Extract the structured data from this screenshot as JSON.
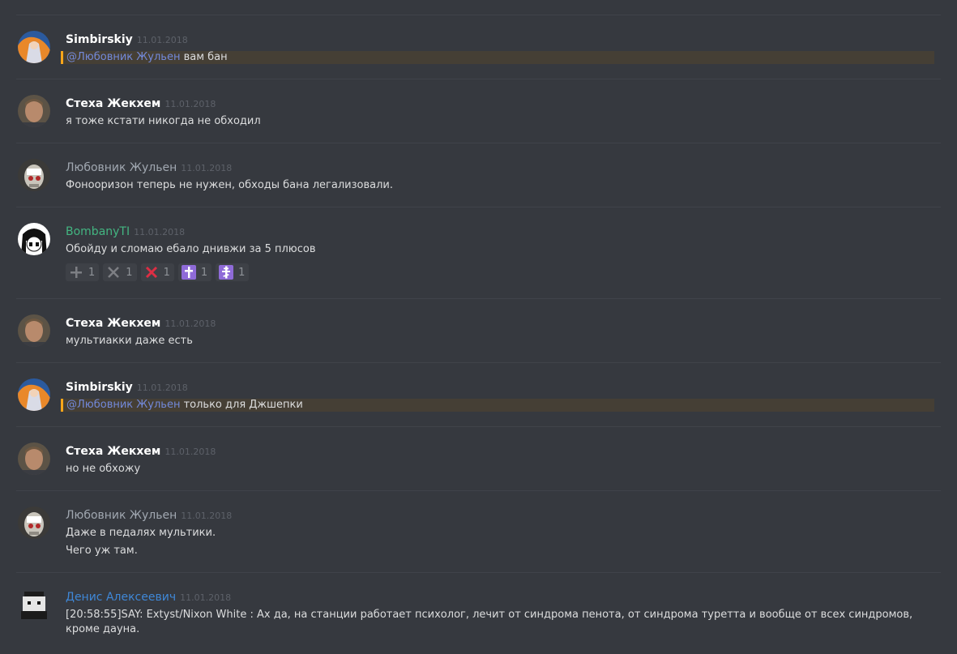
{
  "colors": {
    "background": "#36393f",
    "divider": "#40434a",
    "mention_highlight": "#453f35",
    "mention_bar": "#faa61a",
    "mention_text": "#7289da",
    "green_user": "#43b581",
    "blue_user": "#3f87d6"
  },
  "messages": [
    {
      "author": "Simbirskiy",
      "timestamp": "11.01.2018",
      "avatar": "anime-avatar-icon",
      "mention": "@Любовник Жульен",
      "text": " вам бан"
    },
    {
      "author": "Стеха Жекхем",
      "timestamp": "11.01.2018",
      "avatar": "man-photo-avatar-icon",
      "text": "я тоже кстати никогда не обходил"
    },
    {
      "author": "Любовник Жульен",
      "timestamp": "11.01.2018",
      "avatar": "masked-figure-avatar-icon",
      "text": "Фонооризон теперь не нужен, обходы бана легализовали."
    },
    {
      "author": "BombanyTI",
      "timestamp": "11.01.2018",
      "avatar": "girl-drawing-avatar-icon",
      "text": "Обойду и сломаю ебало днивжи за 5 плюсов",
      "reactions": [
        {
          "icon": "plus-icon",
          "count": "1"
        },
        {
          "icon": "cross-gray-icon",
          "count": "1"
        },
        {
          "icon": "cross-red-icon",
          "count": "1"
        },
        {
          "icon": "latin-cross-icon",
          "count": "1"
        },
        {
          "icon": "orthodox-cross-icon",
          "count": "1"
        }
      ]
    },
    {
      "author": "Стеха Жекхем",
      "timestamp": "11.01.2018",
      "avatar": "man-photo-avatar-icon",
      "text": "мультиакки даже есть"
    },
    {
      "author": "Simbirskiy",
      "timestamp": "11.01.2018",
      "avatar": "anime-avatar-icon",
      "mention": "@Любовник Жульен",
      "text": " только для Джшепки"
    },
    {
      "author": "Стеха Жекхем",
      "timestamp": "11.01.2018",
      "avatar": "man-photo-avatar-icon",
      "text": "но не обхожу"
    },
    {
      "author": "Любовник Жульен",
      "timestamp": "11.01.2018",
      "avatar": "masked-figure-avatar-icon",
      "text": "Даже в педалях мультики.",
      "text2": "Чего уж там."
    },
    {
      "author": "Денис Алексеевич",
      "timestamp": "11.01.2018",
      "avatar": "pixel-character-avatar-icon",
      "text": "[20:58:55]SAY: Extyst/Nixon White : Ах да, на станции работает психолог, лечит от синдрома пенота, от синдрома туретта и вообще от всех синдромов, кроме дауна."
    }
  ]
}
